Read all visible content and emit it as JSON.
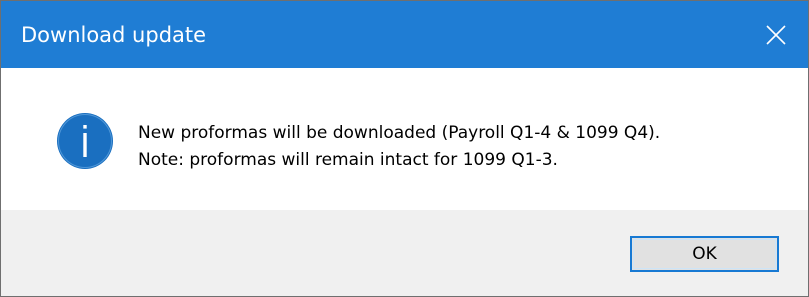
{
  "window": {
    "title": "Download update",
    "close_icon": "close-icon",
    "titlebar_color": "#1f7dd4"
  },
  "message": {
    "icon": "info-icon",
    "icon_color": "#1a6fc0",
    "line1": "New proformas will be downloaded (Payroll Q1-4 & 1099 Q4).",
    "line2": "Note: proformas will remain intact for 1099 Q1-3."
  },
  "footer": {
    "ok_label": "OK"
  }
}
